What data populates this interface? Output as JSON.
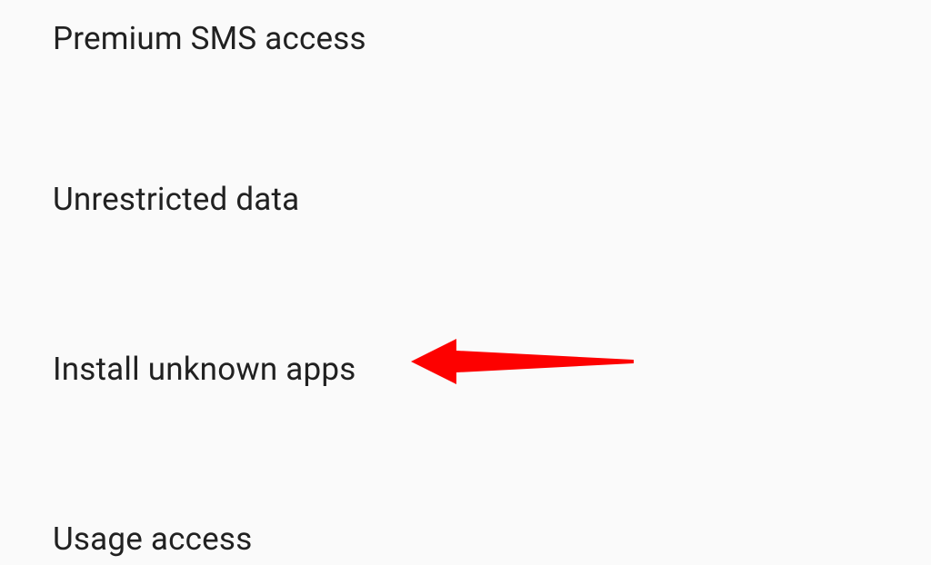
{
  "settings": {
    "items": [
      {
        "label": "Premium SMS access"
      },
      {
        "label": "Unrestricted data"
      },
      {
        "label": "Install unknown apps"
      },
      {
        "label": "Usage access"
      }
    ]
  },
  "annotation": {
    "color": "#fd0100"
  }
}
